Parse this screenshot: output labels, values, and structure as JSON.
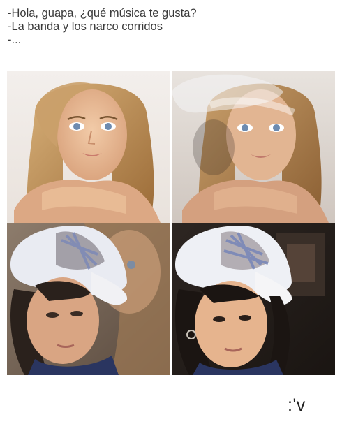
{
  "caption": {
    "line1": "-Hola, guapa, ¿qué música te gusta?",
    "line2": "-La banda y los narco corridos",
    "line3": "-..."
  },
  "panels": [
    {
      "subject": "woman-portrait",
      "style": "original"
    },
    {
      "subject": "woman-portrait-with-cap-overlay",
      "style": "blended"
    },
    {
      "subject": "girl-with-cap-with-woman-overlay",
      "style": "blended"
    },
    {
      "subject": "girl-with-cap",
      "style": "original"
    }
  ],
  "footer": {
    "reaction": ":'v"
  },
  "colors": {
    "background": "#ffffff",
    "caption_text": "#3a3a3a",
    "cap_blue": "#7a88b8",
    "hair_blonde": "#b5894f",
    "skin": "#e6b48e"
  }
}
